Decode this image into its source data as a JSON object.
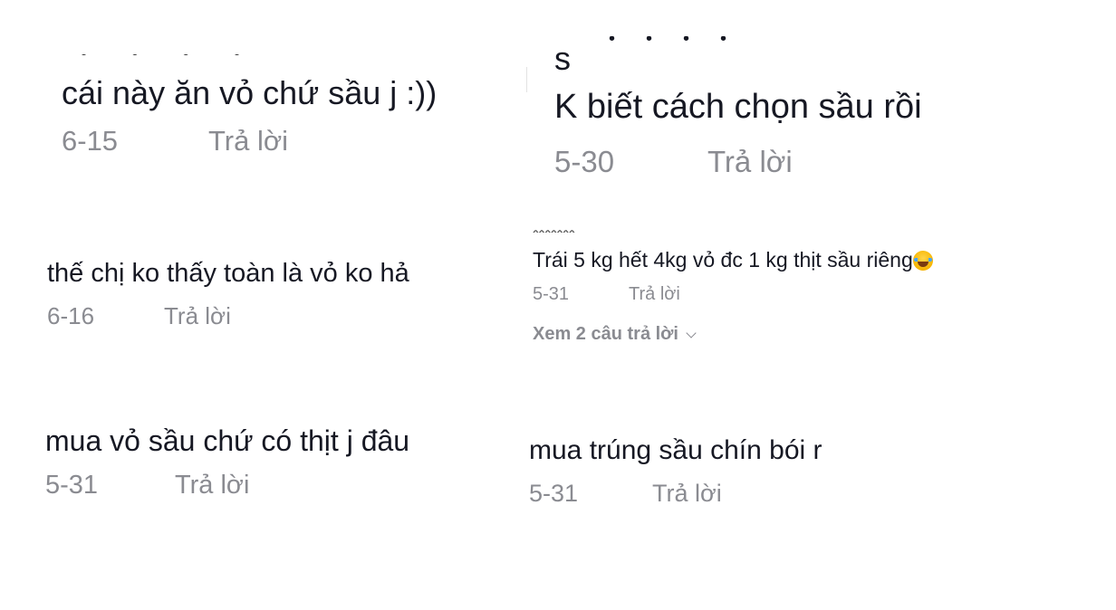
{
  "comments": [
    {
      "text": "cái này ăn vỏ chứ sầu j :))",
      "date": "6-15",
      "reply_label": "Trả lời"
    },
    {
      "username_partial": "s",
      "text": "K biết cách chọn sầu rồi",
      "date": "5-30",
      "reply_label": "Trả lời"
    },
    {
      "text": "thế chị ko thấy toàn là vỏ ko hả",
      "date": "6-16",
      "reply_label": "Trả lời"
    },
    {
      "text": "Trái 5 kg hết 4kg vỏ đc 1 kg thịt sầu riêng",
      "emoji": "face-with-tears-of-joy-icon",
      "date": "5-31",
      "reply_label": "Trả lời",
      "more_replies": "Xem 2 câu trả lời"
    },
    {
      "text": "mua vỏ sầu chứ có thịt j đâu",
      "date": "5-31",
      "reply_label": "Trả lời"
    },
    {
      "text": "mua trúng sầu chín bói r",
      "date": "5-31",
      "reply_label": "Trả lời"
    }
  ]
}
